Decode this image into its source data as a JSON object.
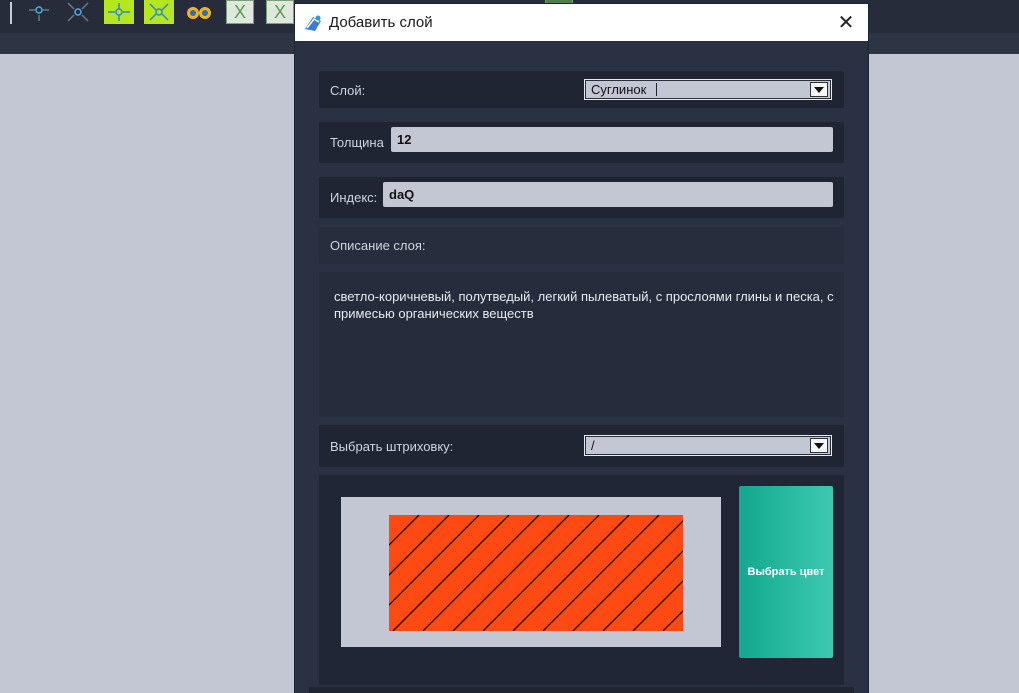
{
  "background": {
    "toolbar_icons": [
      "move-icon",
      "shrink-icon",
      "expand-icon",
      "collapse-icon",
      "binoculars-icon",
      "excel-icon",
      "excel-icon",
      "excel-icon",
      "excel-icon",
      "excel-icon",
      "excel-icon"
    ],
    "colors": {
      "toolbar": "#262c3a",
      "workspace": "#c3c7d4",
      "lime": "#b6e61d"
    },
    "excel_glyph": "X"
  },
  "dialog": {
    "title": "Добавить слой",
    "close_glyph": "✕",
    "layer": {
      "label": "Слой:",
      "value": "Суглинок"
    },
    "thickness": {
      "label": "Толщина",
      "value": "12"
    },
    "index": {
      "label": "Индекс:",
      "value": "daQ"
    },
    "description": {
      "label": "Описание слоя:",
      "text": "светло-коричневый, полутведый, легкий пылеватый, с прослоями глины и песка, с примесью органических веществ"
    },
    "hatch": {
      "label": "Выбрать штриховку:",
      "value": "/"
    },
    "preview": {
      "fill_color": "#ff4a14",
      "hatch_color": "#000000"
    },
    "choose_color_button": "Выбрать цвет",
    "colors": {
      "accent": "#1ab39a",
      "panel": "#1f2533",
      "dialog": "#2a3142"
    }
  }
}
